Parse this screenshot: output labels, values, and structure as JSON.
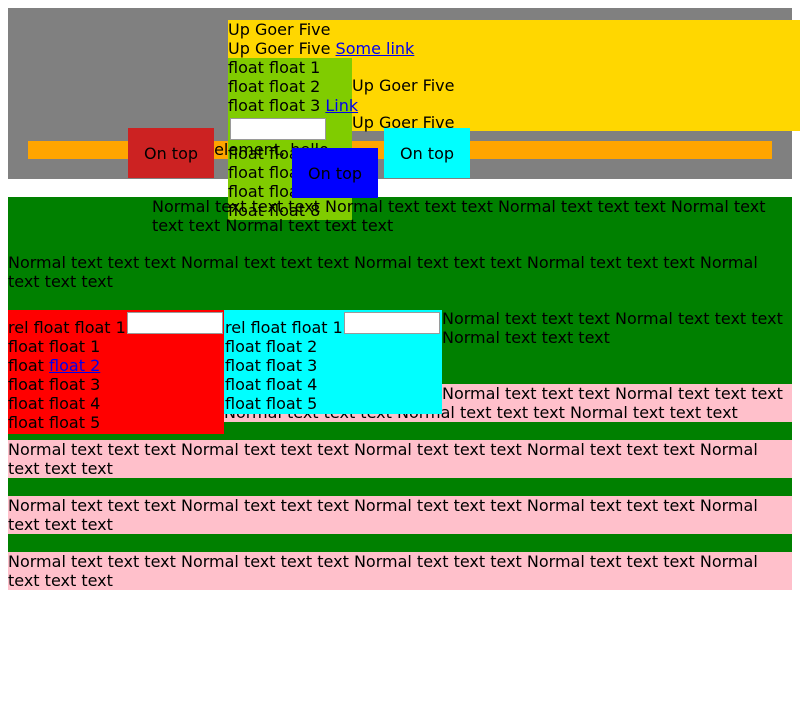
{
  "colors": {
    "gray_header": "#808080",
    "yellow_panel": "#ffd700",
    "green_float": "#80cc00",
    "orange_bar": "#ffa500",
    "red_box": "#cc2222",
    "blue_box": "#0000ff",
    "cyan_box": "#00ffff",
    "dark_green": "#008000",
    "pink": "#ffc0cb",
    "red_float": "#ff0000",
    "link": "#0000ee"
  },
  "top": {
    "goer_line1": "Up Goer Five",
    "goer_line2": "Up Goer Five",
    "some_link": "Some link",
    "float_line1": "float float 1",
    "float_line2": "float float 2",
    "float_line3": "float float 3",
    "float_link": "Link",
    "goer_right_1": "Up Goer Five",
    "goer_right_2": "Up Goer Five",
    "float_cont_1": "float float 4",
    "float_cont_2": "float float 5",
    "float_cont_3": "float float 6",
    "float_cont_4": "float float 8",
    "outside_text": "outside element, hello",
    "on_top_red": "On top",
    "on_top_blue": "On top",
    "on_top_cyan": "On top",
    "top_input_value": ""
  },
  "normal_text": {
    "row_a": "Normal text text text Normal text text text Normal text text text Normal text text text Normal text text text",
    "row_b": "Normal text text text Normal text text text Normal text text text Normal text text text Normal text text text",
    "row_c": "Normal text text text Normal text text text Normal text text text",
    "row_d": "Normal text text text Normal text text text Normal text text text Normal text text text Normal text text text",
    "row_e": "Normal text text text Normal text text text Normal text text text Normal text text text Normal text text text",
    "row_f": "Normal text text text Normal text text text Normal text text text Normal text text text Normal text text text",
    "row_g": "Normal text text text Normal text text text Normal text text text Normal text text text Normal text text text"
  },
  "red_float": {
    "line1": "rel float float 1",
    "line2": "float float 1",
    "line3_prefix": "float",
    "line3_link": "float 2",
    "line4": "float float 3",
    "line5": "float float 4",
    "line6": "float float 5",
    "input_value": ""
  },
  "cyan_float": {
    "line1": "rel float float 1",
    "line2": "float float 2",
    "line3": "float float 3",
    "line4": "float float 4",
    "line5": "float float 5",
    "input_value": ""
  }
}
